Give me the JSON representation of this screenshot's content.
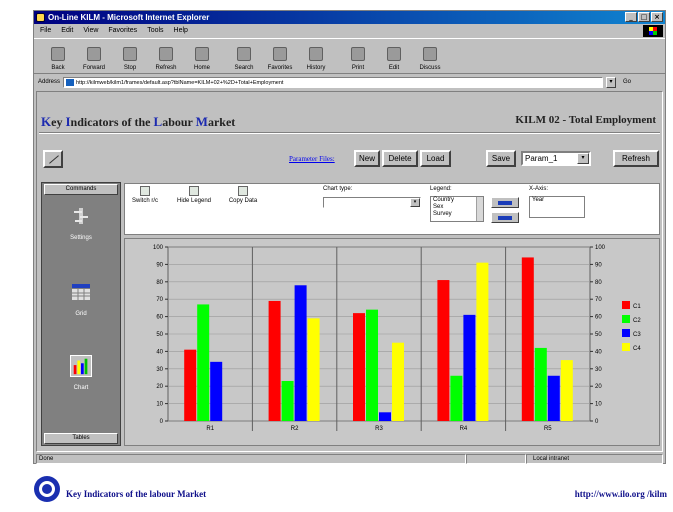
{
  "window": {
    "title": "On-Line KILM - Microsoft Internet Explorer"
  },
  "menu": [
    "File",
    "Edit",
    "View",
    "Favorites",
    "Tools",
    "Help"
  ],
  "toolbar": [
    "Back",
    "Forward",
    "Stop",
    "Refresh",
    "Home",
    "Search",
    "Favorites",
    "History",
    "Print",
    "Edit",
    "Discuss"
  ],
  "address": {
    "label": "Address",
    "url": "http://kilmweb/kilm1/frames/default.asp?tblName=KILM+02+%2D+Total+Employment",
    "go": "Go"
  },
  "page": {
    "title_parts": [
      "K",
      "ey ",
      "I",
      "ndicators of the ",
      "L",
      "abour ",
      "M",
      "arket"
    ],
    "kilm_code": "KILM 02 - Total Employment",
    "param_link": "Parameter Files:",
    "buttons": {
      "new": "New",
      "delete": "Delete",
      "load": "Load",
      "save": "Save",
      "refresh": "Refresh"
    },
    "param_select": "Param_1"
  },
  "sidebar": {
    "header": "Commands",
    "items": [
      "Settings",
      "Grid",
      "Chart"
    ],
    "footer": "Tables"
  },
  "controls": {
    "switch": "Switch r/c",
    "hide_legend": "Hide Legend",
    "copy_data": "Copy Data",
    "chart_type_label": "Chart type:",
    "legend_label": "Legend:",
    "legend_items": [
      "Country",
      "Sex",
      "Survey"
    ],
    "xaxis_label": "X-Axis:",
    "xaxis_items": [
      "Year"
    ]
  },
  "chart_data": {
    "type": "bar",
    "categories": [
      "R1",
      "R2",
      "R3",
      "R4",
      "R5"
    ],
    "series": [
      {
        "name": "C1",
        "values": [
          41,
          69,
          62,
          81,
          94
        ],
        "color": "#ff0000"
      },
      {
        "name": "C2",
        "values": [
          67,
          23,
          64,
          26,
          42
        ],
        "color": "#00ff00"
      },
      {
        "name": "C3",
        "values": [
          34,
          78,
          5,
          61,
          26
        ],
        "color": "#0000ff"
      },
      {
        "name": "C4",
        "values": [
          0,
          59,
          45,
          91,
          35
        ],
        "color": "#ffff00"
      }
    ],
    "ylim": [
      0,
      100
    ],
    "yticks": [
      "0",
      "10",
      "20",
      "30",
      "40",
      "50",
      "60",
      "70",
      "80",
      "90",
      "100"
    ],
    "grid": true,
    "legend": "right"
  },
  "status": {
    "left": "Done",
    "right": "Local intranet"
  },
  "footer": {
    "left": "Key Indicators of the labour Market",
    "right": "http://www.ilo.org /kilm"
  }
}
